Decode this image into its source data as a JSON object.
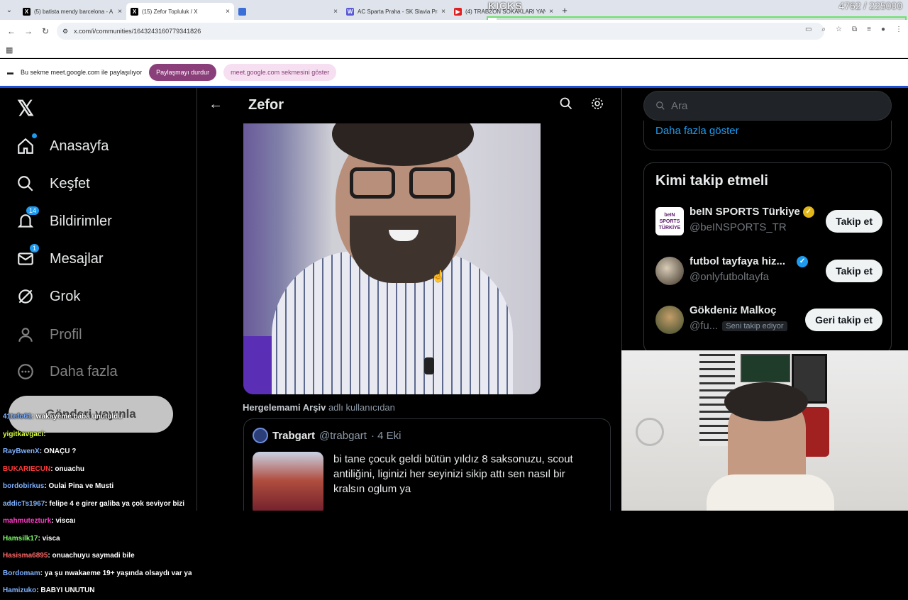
{
  "browser": {
    "tabs": [
      {
        "title": "(5) batista mendy barcelona - A",
        "fav": "X",
        "fav_color": "#000000",
        "active": false
      },
      {
        "title": "(15) Zefor Topluluk / X",
        "fav": "X",
        "fav_color": "#000000",
        "active": true
      },
      {
        "title": "",
        "fav": "",
        "fav_color": "#3b6fd8",
        "active": false
      },
      {
        "title": "AC Sparta Praha - SK Slavia Pra",
        "fav": "W",
        "fav_color": "#5a5ad6",
        "active": false
      },
      {
        "title": "(4) TRABZON SOKAKLARI YANIY",
        "fav": "▶",
        "fav_color": "#e02020",
        "active": false
      }
    ],
    "new_tab": "+",
    "url": "x.com/i/communities/1643243160779341826"
  },
  "kicks": {
    "label": "KICKS",
    "count": "4762 / 225000",
    "progress": 0.021
  },
  "share_bar": {
    "message": "Bu sekme meet.google.com ile paylaşılıyor",
    "stop_button": "Paylaşmayı durdur",
    "show_button": "meet.google.com sekmesini göster"
  },
  "nav": {
    "logo": "𝕏",
    "items": [
      {
        "label": "Anasayfa",
        "icon": "home-icon"
      },
      {
        "label": "Keşfet",
        "icon": "search-icon"
      },
      {
        "label": "Bildirimler",
        "icon": "bell-icon",
        "badge": "14"
      },
      {
        "label": "Mesajlar",
        "icon": "mail-icon",
        "badge": "1"
      },
      {
        "label": "Grok",
        "icon": "grok-icon"
      },
      {
        "label": "Profil",
        "icon": "person-icon"
      },
      {
        "label": "Daha fazla",
        "icon": "more-icon"
      }
    ],
    "post_button": "Gönderi yayınla"
  },
  "main": {
    "title": "Zefor",
    "repost_user": "Hergelemami Arşiv",
    "repost_suffix": "adlı kullanıcıdan",
    "quote": {
      "name": "Trabgart",
      "handle": "@trabgart",
      "date": "· 4 Eki",
      "text": "bi tane çocuk geldi bütün yıldız 8 saksonuzu, scout antiliğini, liginizi her seyinizi sikip attı sen nasıl bir kralsın oglum ya"
    }
  },
  "right": {
    "search_placeholder": "Ara",
    "more_link": "Daha fazla göster",
    "who_to_follow_title": "Kimi takip etmeli",
    "accounts": [
      {
        "name": "beIN SPORTS Türkiye",
        "handle": "@beINSPORTS_TR",
        "button": "Takip et",
        "verified": "gold",
        "follows_you": ""
      },
      {
        "name": "futbol tayfaya hiz...",
        "handle": "@onlyfutboltayfa",
        "button": "Takip et",
        "verified": "blue",
        "follows_you": ""
      },
      {
        "name": "Gökdeniz Malkoç",
        "handle": "@fu...",
        "button": "Geri takip et",
        "verified": "",
        "follows_you": "Seni takip ediyor"
      }
    ],
    "bein_logo_text": "beIN SPORTS TÜRKİYE"
  },
  "chat": [
    {
      "user": "41tefo61",
      "color": "#7fb2ff",
      "msg": ": wakayeme baba unutuldu"
    },
    {
      "user": "yigitkavgaci",
      "color": "#d8ff3c",
      "msg": ":"
    },
    {
      "user": "RayBwenX",
      "color": "#7fb2ff",
      "msg": ": ONAÇU ?"
    },
    {
      "user": "BUKARIECUN",
      "color": "#ff3c3c",
      "msg": ": onuachu"
    },
    {
      "user": "bordobirkus",
      "color": "#7fb2ff",
      "msg": ": Oulai Pina ve Musti"
    },
    {
      "user": "addicTs1967",
      "color": "#7fb2ff",
      "msg": ": felipe 4 e girer galiba ya çok seviyor bizi"
    },
    {
      "user": "mahmutezturk",
      "color": "#ff3cc8",
      "msg": ": viscaı"
    },
    {
      "user": "Hamsilk17",
      "color": "#7dff6a",
      "msg": ": visca"
    },
    {
      "user": "Hasisma6895",
      "color": "#ff6a6a",
      "msg": ": onuachuyu saymadi bile"
    },
    {
      "user": "Bordomam",
      "color": "#7fb2ff",
      "msg": ": ya şu nwakaeme 19+ yaşında olsaydı var ya"
    },
    {
      "user": "Hamizuko",
      "color": "#7fb2ff",
      "msg": ": BABYI UNUTUN"
    }
  ],
  "colors": {
    "accent": "#1d9bf0",
    "chrome": "#dfe3eb",
    "share_primary": "#8a3f7a"
  }
}
